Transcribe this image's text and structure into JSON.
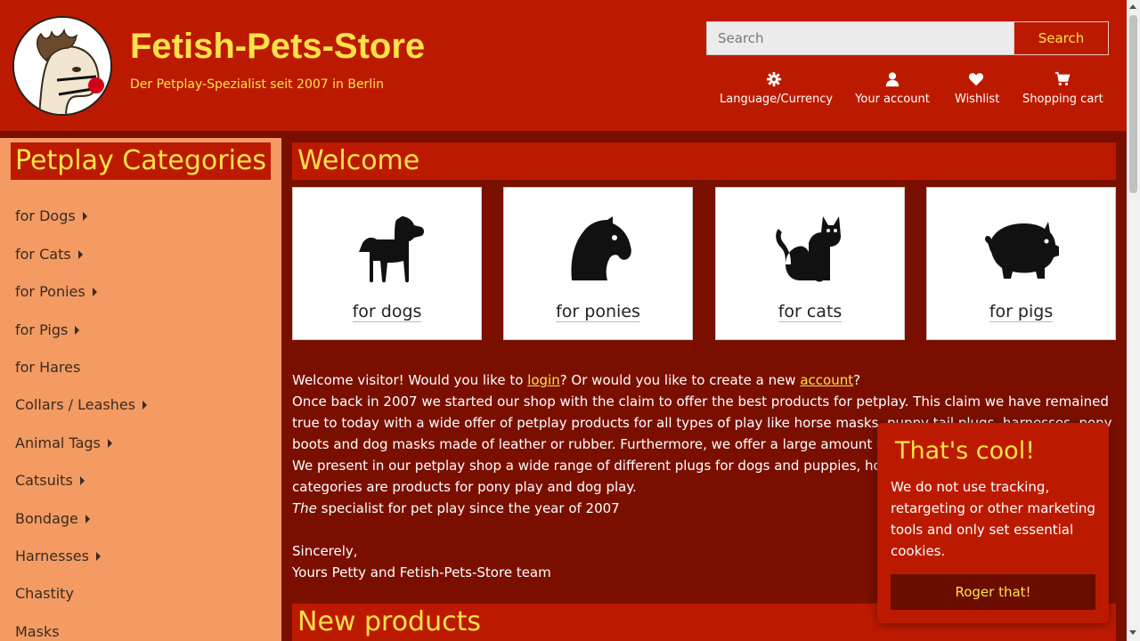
{
  "header": {
    "title": "Fetish-Pets-Store",
    "tagline": "Der Petplay-Spezialist seit 2007 in Berlin",
    "search_placeholder": "Search",
    "search_button": "Search",
    "nav": [
      {
        "label": "Language/Currency",
        "icon": "gear-icon"
      },
      {
        "label": "Your account",
        "icon": "user-icon"
      },
      {
        "label": "Wishlist",
        "icon": "heart-icon"
      },
      {
        "label": "Shopping cart",
        "icon": "cart-icon"
      }
    ]
  },
  "sidebar": {
    "title": "Petplay Categories",
    "items": [
      {
        "label": "for Dogs",
        "submenu": true
      },
      {
        "label": "for Cats",
        "submenu": true
      },
      {
        "label": "for Ponies",
        "submenu": true
      },
      {
        "label": "for Pigs",
        "submenu": true
      },
      {
        "label": "for Hares",
        "submenu": false
      },
      {
        "label": "Collars / Leashes",
        "submenu": true
      },
      {
        "label": "Animal Tags",
        "submenu": true
      },
      {
        "label": "Catsuits",
        "submenu": true
      },
      {
        "label": "Bondage",
        "submenu": true
      },
      {
        "label": "Harnesses",
        "submenu": true
      },
      {
        "label": "Chastity",
        "submenu": false
      },
      {
        "label": "Masks",
        "submenu": false
      }
    ]
  },
  "main": {
    "welcome_title": "Welcome",
    "cards": [
      {
        "label": "for dogs",
        "icon": "dog-icon"
      },
      {
        "label": "for ponies",
        "icon": "horse-icon"
      },
      {
        "label": "for cats",
        "icon": "cat-icon"
      },
      {
        "label": "for pigs",
        "icon": "pig-icon"
      }
    ],
    "intro_pre": "Welcome visitor! Would you like to ",
    "login_link": "login",
    "intro_mid": "? Or would you like to create a new ",
    "account_link": "account",
    "intro_post": "?",
    "paragraph": "Once back in 2007 we started our shop with the claim to offer the best products for petplay. This claim we have remained true to today with a wide offer of petplay products for all types of play like horse masks, puppy tail plugs, harnesses, pony boots and dog masks made of leather or rubber. Furthermore, we offer a large amount of dog and slave tags",
    "paragraph2": "We present in our petplay shop a wide range of different plugs for dogs and puppies, horses and",
    "paragraph3": "categories are products for pony play and dog play.",
    "specialist_em": "The",
    "specialist_rest": " specialist for pet play since the year of 2007",
    "sincerely": "Sincerely,",
    "signoff": "Yours Petty and Fetish-Pets-Store team",
    "new_products_title": "New products"
  },
  "cookie": {
    "title": "That's cool!",
    "text": "We do not use tracking, retargeting or other marketing tools and only set essential cookies.",
    "button": "Roger that!"
  },
  "colors": {
    "header_bg": "#bc1a00",
    "accent_yellow": "#ffe14a",
    "sidebar_bg": "#f39b63",
    "page_bg": "#7a0f00"
  }
}
